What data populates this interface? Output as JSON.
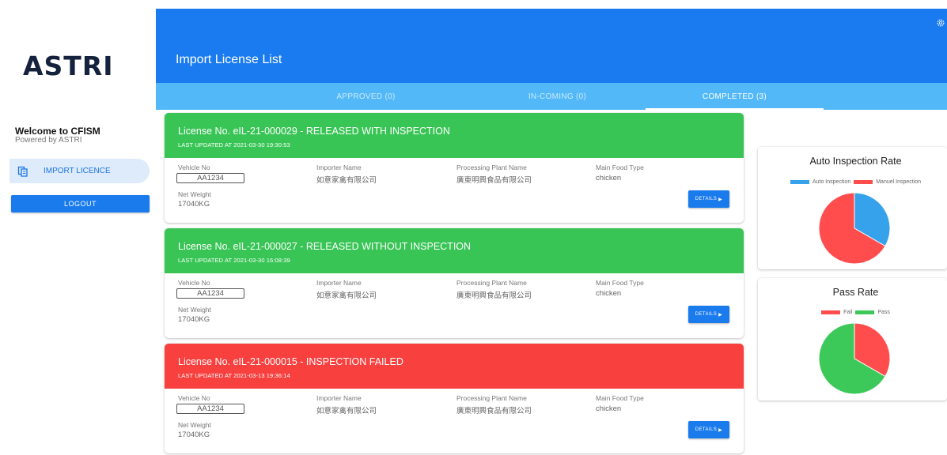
{
  "sidebar": {
    "logo": "ASTRI",
    "welcome": "Welcome to CFISM",
    "powered_by": "Powered by ASTRI",
    "nav_item": "IMPORT LICENCE",
    "logout": "LOGOUT"
  },
  "header": {
    "title": "Import License List",
    "tabs": [
      "APPROVED (0)",
      "IN-COMING (0)",
      "COMPLETED (3)"
    ],
    "active_tab": 2
  },
  "field_labels": {
    "vehicle": "Vehicle No",
    "importer": "Importer Name",
    "plant": "Processing Plant Name",
    "food": "Main Food Type",
    "weight": "Net Weight"
  },
  "licenses": [
    {
      "title": "License No. eIL-21-000029 - RELEASED WITH INSPECTION",
      "updated": "LAST UPDATED AT 2021-03-30 19:30:53",
      "status_color": "#39c556",
      "vehicle": "AA1234",
      "importer": "如意家禽有限公司",
      "plant": "廣東明興食品有限公司",
      "food": "chicken",
      "weight": "17040KG",
      "details": "DETAILS"
    },
    {
      "title": "License No. eIL-21-000027 - RELEASED WITHOUT INSPECTION",
      "updated": "LAST UPDATED AT 2021-03-30 16:08:39",
      "status_color": "#39c556",
      "vehicle": "AA1234",
      "importer": "如意家禽有限公司",
      "plant": "廣東明興食品有限公司",
      "food": "chicken",
      "weight": "17040KG",
      "details": "DETAILS"
    },
    {
      "title": "License No. eIL-21-000015 - INSPECTION FAILED",
      "updated": "LAST UPDATED AT 2021-03-13 19:36:14",
      "status_color": "#f8403f",
      "vehicle": "AA1234",
      "importer": "如意家禽有限公司",
      "plant": "廣東明興食品有限公司",
      "food": "chicken",
      "weight": "17040KG",
      "details": "DETAILS"
    }
  ],
  "chart_data": [
    {
      "type": "pie",
      "title": "Auto Inspection Rate",
      "categories": [
        "Auto Inspection",
        "Manuel Inspection"
      ],
      "values": [
        1,
        2
      ],
      "colors": [
        "#36a2eb",
        "#ff4d4d"
      ],
      "legend": "top"
    },
    {
      "type": "pie",
      "title": "Pass Rate",
      "categories": [
        "Fail",
        "Pass"
      ],
      "values": [
        1,
        2
      ],
      "colors": [
        "#ff4d4d",
        "#3dc95a"
      ],
      "legend": "top"
    }
  ]
}
